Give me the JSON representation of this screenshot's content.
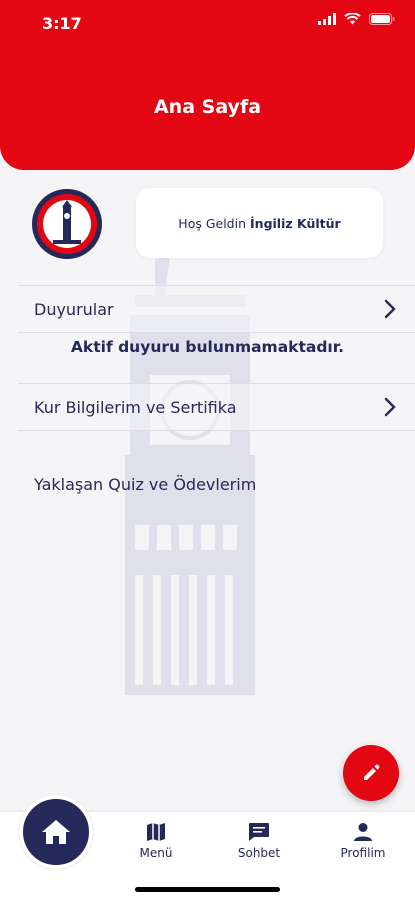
{
  "status_bar": {
    "time": "3:17"
  },
  "header": {
    "title": "Ana Sayfa"
  },
  "welcome": {
    "greeting": "Hoş Geldin",
    "name": "İngiliz Kültür"
  },
  "sections": [
    {
      "label": "Duyurular"
    },
    {
      "label": "Kur Bilgilerim ve Sertifika"
    },
    {
      "label": "Yaklaşan Quiz ve Ödevlerim"
    }
  ],
  "announcements": {
    "empty_message": "Aktif duyuru bulunmamaktadır."
  },
  "tabs": [
    {
      "label": "Menü",
      "icon": "map-icon"
    },
    {
      "label": "Sohbet",
      "icon": "chat-icon"
    },
    {
      "label": "Profilim",
      "icon": "person-icon"
    }
  ],
  "colors": {
    "brand_red": "#e30613",
    "navy": "#24295a",
    "background": "#f5f5f8"
  }
}
